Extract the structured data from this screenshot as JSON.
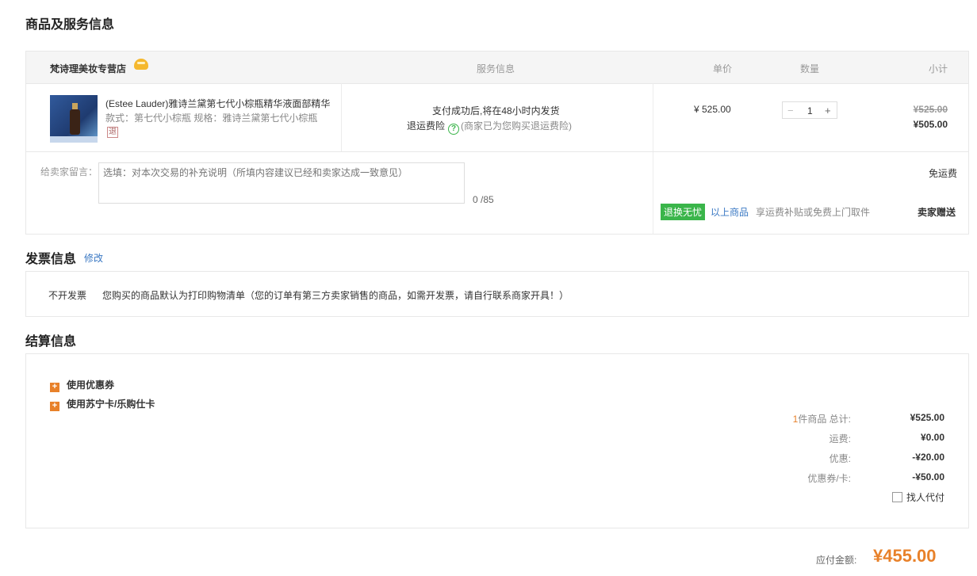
{
  "goods": {
    "title": "商品及服务信息",
    "shop_name": "梵诗理美妆专营店",
    "col_service": "服务信息",
    "col_price": "单价",
    "col_qty": "数量",
    "col_subtotal": "小计",
    "product": {
      "name": "(Estee Lauder)雅诗兰黛第七代小棕瓶精华液面部精华",
      "spec": "款式：第七代小棕瓶   规格：雅诗兰黛第七代小棕瓶",
      "badge": "退",
      "delivery": "支付成功后,将在48小时内发货",
      "return_ins_label": "退运费险",
      "return_ins_note": "(商家已为您购买退运费险)",
      "unit_price": "¥ 525.00",
      "quantity": "1",
      "minus": "−",
      "plus": "+",
      "original_subtotal": "¥525.00",
      "subtotal": "¥505.00"
    },
    "message": {
      "label": "给卖家留言：",
      "placeholder": "选填：对本次交易的补充说明（所填内容建议已经和卖家达成一致意见）",
      "counter": "0 /85"
    },
    "shipping": {
      "fee": "免运费",
      "tag": "退换无忧",
      "applies_to": "以上商品",
      "benefit": "享运费补贴或免费上门取件",
      "gift": "卖家赠送"
    }
  },
  "invoice": {
    "title": "发票信息",
    "modify": "修改",
    "type": "不开发票",
    "description": "您购买的商品默认为打印购物清单（您的订单有第三方卖家销售的商品，如需开发票，请自行联系商家开具！）"
  },
  "settlement": {
    "title": "结算信息",
    "coupon_option": "使用优惠券",
    "card_option": "使用苏宁卡/乐购仕卡",
    "items_count": "1",
    "items_label": "件商品 总计:",
    "items_total": "¥525.00",
    "shipping_label": "运费:",
    "shipping_value": "¥0.00",
    "discount_label": "优惠:",
    "discount_value": "-¥20.00",
    "coupon_label": "优惠券/卡:",
    "coupon_value": "-¥50.00",
    "proxy_pay": "找人代付",
    "payable_label": "应付金额:",
    "payable_value": "¥455.00"
  },
  "colors": {
    "accent": "#e8812a",
    "green": "#3ab54a",
    "link": "#3a78c3"
  }
}
